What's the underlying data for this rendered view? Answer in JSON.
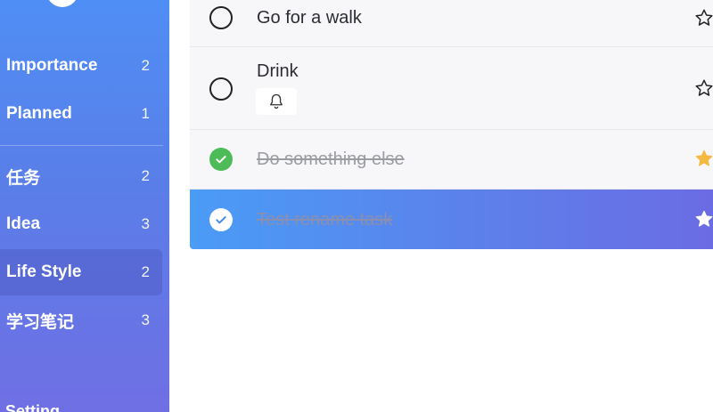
{
  "sidebar": {
    "items": [
      {
        "label": "Importance",
        "count": "2"
      },
      {
        "label": "Planned",
        "count": "1"
      },
      {
        "label": "任务",
        "count": "2"
      },
      {
        "label": "Idea",
        "count": "3"
      },
      {
        "label": "Life Style",
        "count": "2"
      },
      {
        "label": "学习笔记",
        "count": "3"
      }
    ],
    "active_item": "Life Style",
    "setting_label": "Setting"
  },
  "tasks": [
    {
      "title": "Go for a walk",
      "completed": false,
      "starred": false
    },
    {
      "title": "Drink",
      "completed": false,
      "starred": false,
      "reminder_icon": "bell-icon"
    },
    {
      "title": "Do something else",
      "completed": true,
      "starred": true
    },
    {
      "title": "Test rename task",
      "completed": true,
      "starred": true,
      "selected": true
    }
  ],
  "colors": {
    "sidebar_top": "#4f8ef5",
    "sidebar_bottom": "#6f6fe3",
    "check_done": "#4cbb58",
    "star_filled": "#f5b942",
    "selected_row_start": "#4a9cf6",
    "selected_row_end": "#6c6be4"
  }
}
